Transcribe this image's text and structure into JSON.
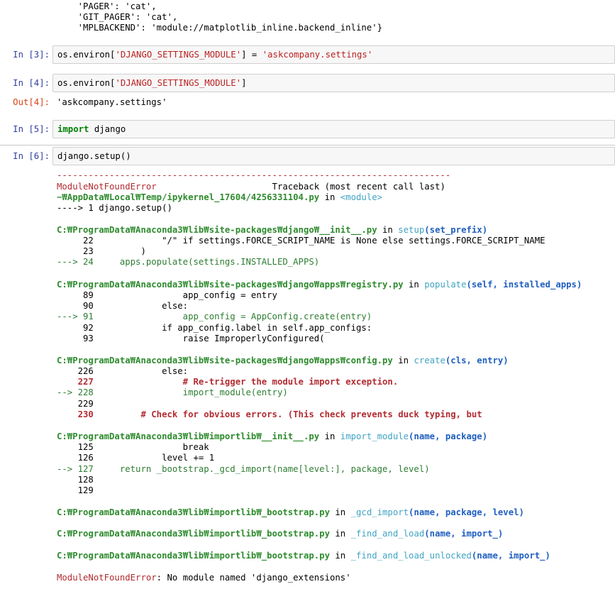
{
  "top_output": {
    "lines": [
      "    'PAGER': 'cat',",
      "    'GIT_PAGER': 'cat',",
      "    'MPLBACKEND': 'module://matplotlib_inline.backend_inline'}"
    ]
  },
  "cells": [
    {
      "in_prompt": "In [3]:",
      "code_a": "os.environ[",
      "code_str": "'DJANGO_SETTINGS_MODULE'",
      "code_b": "] = ",
      "code_str2": "'askcompany.settings'"
    },
    {
      "in_prompt": "In [4]:",
      "code_a": "os.environ[",
      "code_str": "'DJANGO_SETTINGS_MODULE'",
      "code_b": "]",
      "out_prompt": "Out[4]:",
      "out_text": "'askcompany.settings'"
    },
    {
      "in_prompt": "In [5]:",
      "kw": "import",
      "rest": " django"
    },
    {
      "in_prompt": "In [6]:",
      "code": "django.setup()"
    }
  ],
  "traceback": {
    "dashes": "---------------------------------------------------------------------------",
    "err_name": "ModuleNotFoundError",
    "header_right": "                      Traceback (most recent call last)",
    "frame0": {
      "path": "~₩AppData₩Local₩Temp/ipykernel_17604/4256331104.py",
      "in": " in ",
      "func": "<module>",
      "line": "----> 1 django.setup()"
    },
    "frame1": {
      "path": "C:₩ProgramData₩Anaconda3₩lib₩site-packages₩django₩__init__.py",
      "in": " in ",
      "func": "setup",
      "args": "(set_prefix)",
      "l1": "     22             \"/\" if settings.FORCE_SCRIPT_NAME is None else settings.FORCE_SCRIPT_NAME",
      "l2": "     23         )",
      "l3": "---> 24     apps.populate(settings.INSTALLED_APPS)"
    },
    "frame2": {
      "path": "C:₩ProgramData₩Anaconda3₩lib₩site-packages₩django₩apps₩registry.py",
      "in": " in ",
      "func": "populate",
      "args": "(self, installed_apps)",
      "l1": "     89                 app_config = entry",
      "l2": "     90             else:",
      "l3": "---> 91                 app_config = AppConfig.create(entry)",
      "l4": "     92             if app_config.label in self.app_configs:",
      "l5": "     93                 raise ImproperlyConfigured("
    },
    "frame3": {
      "path": "C:₩ProgramData₩Anaconda3₩lib₩site-packages₩django₩apps₩config.py",
      "in": " in ",
      "func": "create",
      "args": "(cls, entry)",
      "l1": "    226             else:",
      "l2": "    227                 # Re-trigger the module import exception.",
      "l3": "--> 228                 import_module(entry)",
      "l4": "    229",
      "l5": "    230         # Check for obvious errors. (This check prevents duck typing, but"
    },
    "frame4": {
      "path": "C:₩ProgramData₩Anaconda3₩lib₩importlib₩__init__.py",
      "in": " in ",
      "func": "import_module",
      "args": "(name, package)",
      "l1": "    125                 break",
      "l2": "    126             level += 1",
      "l3": "--> 127     return _bootstrap._gcd_import(name[level:], package, level)",
      "l4": "    128",
      "l5": "    129"
    },
    "frame5": {
      "path": "C:₩ProgramData₩Anaconda3₩lib₩importlib₩_bootstrap.py",
      "in": " in ",
      "func": "_gcd_import",
      "args": "(name, package, level)"
    },
    "frame6": {
      "path": "C:₩ProgramData₩Anaconda3₩lib₩importlib₩_bootstrap.py",
      "in": " in ",
      "func": "_find_and_load",
      "args": "(name, import_)"
    },
    "frame7": {
      "path": "C:₩ProgramData₩Anaconda3₩lib₩importlib₩_bootstrap.py",
      "in": " in ",
      "func": "_find_and_load_unlocked",
      "args": "(name, import_)"
    },
    "final": {
      "err_name": "ModuleNotFoundError",
      "message": ": No module named 'django_extensions'"
    }
  },
  "colors": {
    "prompt_in": "#303f9f",
    "prompt_out": "#d84315",
    "error": "#b22b31",
    "path_green": "#2e8b2e",
    "func_cyan": "#41a4c3",
    "args_blue": "#1f5fbf"
  }
}
